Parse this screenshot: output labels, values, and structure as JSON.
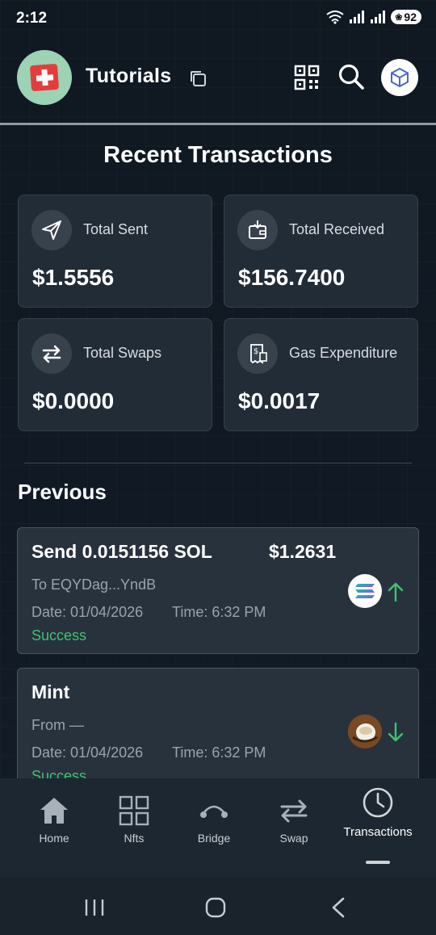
{
  "status_bar": {
    "time": "2:12",
    "battery": "92"
  },
  "header": {
    "title": "Tutorials"
  },
  "page_title": "Recent Transactions",
  "stats": [
    {
      "label": "Total Sent",
      "value": "$1.5556",
      "icon": "send-icon"
    },
    {
      "label": "Total Received",
      "value": "$156.7400",
      "icon": "wallet-receive-icon"
    },
    {
      "label": "Total Swaps",
      "value": "$0.0000",
      "icon": "swap-arrows-icon"
    },
    {
      "label": "Gas Expenditure",
      "value": "$0.0017",
      "icon": "receipt-gas-icon"
    }
  ],
  "section_title": "Previous",
  "transactions": [
    {
      "title": "Send 0.0151156 SOL",
      "amount": "$1.2631",
      "party": "To EQYDag...YndB",
      "date": "Date: 01/04/2026",
      "time": "Time: 6:32 PM",
      "status": "Success",
      "token_icon": "solana-icon",
      "direction": "up"
    },
    {
      "title": "Mint",
      "amount": "",
      "party": "From —",
      "date": "Date: 01/04/2026",
      "time": "Time: 6:32 PM",
      "status": "Success",
      "token_icon": "nft-thumbnail",
      "direction": "down"
    }
  ],
  "nav": [
    {
      "label": "Home",
      "icon": "home-icon"
    },
    {
      "label": "Nfts",
      "icon": "grid-icon"
    },
    {
      "label": "Bridge",
      "icon": "bridge-icon"
    },
    {
      "label": "Swap",
      "icon": "swap-icon"
    },
    {
      "label": "Transactions",
      "icon": "clock-icon",
      "active": true
    }
  ],
  "colors": {
    "success": "#3ec46d",
    "background": "#111a24",
    "card": "#222c37"
  }
}
